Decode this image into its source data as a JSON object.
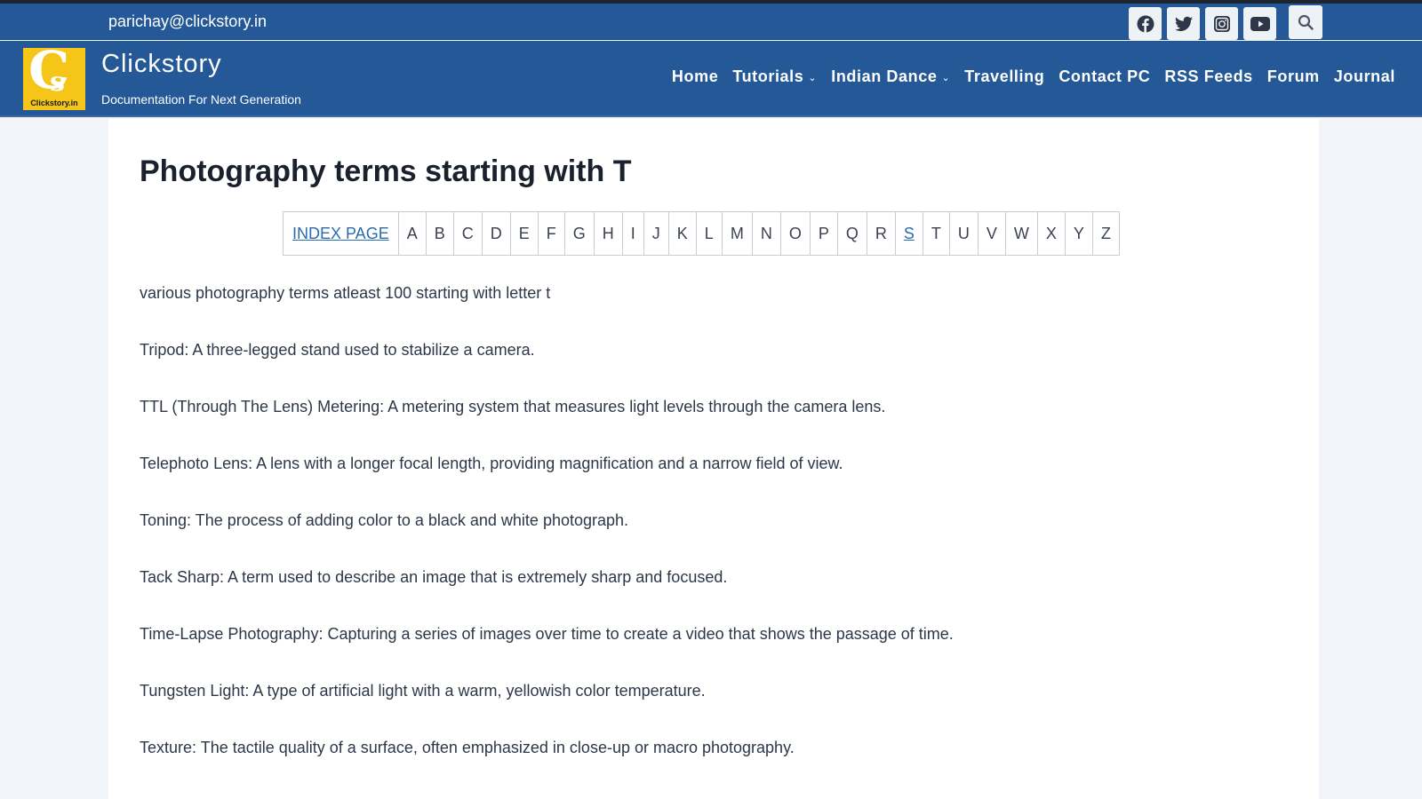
{
  "topbar": {
    "email": "parichay@clickstory.in",
    "social": [
      {
        "name": "facebook",
        "icon": "facebook-icon"
      },
      {
        "name": "twitter",
        "icon": "twitter-icon"
      },
      {
        "name": "instagram",
        "icon": "instagram-icon"
      },
      {
        "name": "youtube",
        "icon": "youtube-icon"
      }
    ],
    "search_icon": "search-icon"
  },
  "header": {
    "logo_text": "Clickstory.in",
    "logo_letters": {
      "big": "C",
      "small": "s"
    },
    "site_title": "Clickstory",
    "tagline": "Documentation For Next Generation",
    "nav": [
      {
        "label": "Home",
        "dropdown": false
      },
      {
        "label": "Tutorials",
        "dropdown": true
      },
      {
        "label": "Indian Dance",
        "dropdown": true
      },
      {
        "label": "Travelling",
        "dropdown": false
      },
      {
        "label": "Contact PC",
        "dropdown": false
      },
      {
        "label": "RSS Feeds",
        "dropdown": false
      },
      {
        "label": "Forum",
        "dropdown": false
      },
      {
        "label": "Journal",
        "dropdown": false
      }
    ],
    "chevron": "⌄"
  },
  "colors": {
    "header_bg": "#245896",
    "link": "#2b6cb0",
    "page_bg": "#f2f6fa",
    "logo_bg": "#f5c518"
  },
  "main": {
    "title": "Photography terms starting with T",
    "index": {
      "index_label": "INDEX PAGE",
      "letters": [
        "A",
        "B",
        "C",
        "D",
        "E",
        "F",
        "G",
        "H",
        "I",
        "J",
        "K",
        "L",
        "M",
        "N",
        "O",
        "P",
        "Q",
        "R",
        "S",
        "T",
        "U",
        "V",
        "W",
        "X",
        "Y",
        "Z"
      ],
      "linked_letters": [
        "S"
      ]
    },
    "intro": "various photography terms atleast 100 starting with letter t",
    "terms": [
      "Tripod: A three-legged stand used to stabilize a camera.",
      "TTL (Through The Lens) Metering: A metering system that measures light levels through the camera lens.",
      "Telephoto Lens: A lens with a longer focal length, providing magnification and a narrow field of view.",
      "Toning: The process of adding color to a black and white photograph.",
      "Tack Sharp: A term used to describe an image that is extremely sharp and focused.",
      "Time-Lapse Photography: Capturing a series of images over time to create a video that shows the passage of time.",
      "Tungsten Light: A type of artificial light with a warm, yellowish color temperature.",
      "Texture: The tactile quality of a surface, often emphasized in close-up or macro photography."
    ]
  }
}
